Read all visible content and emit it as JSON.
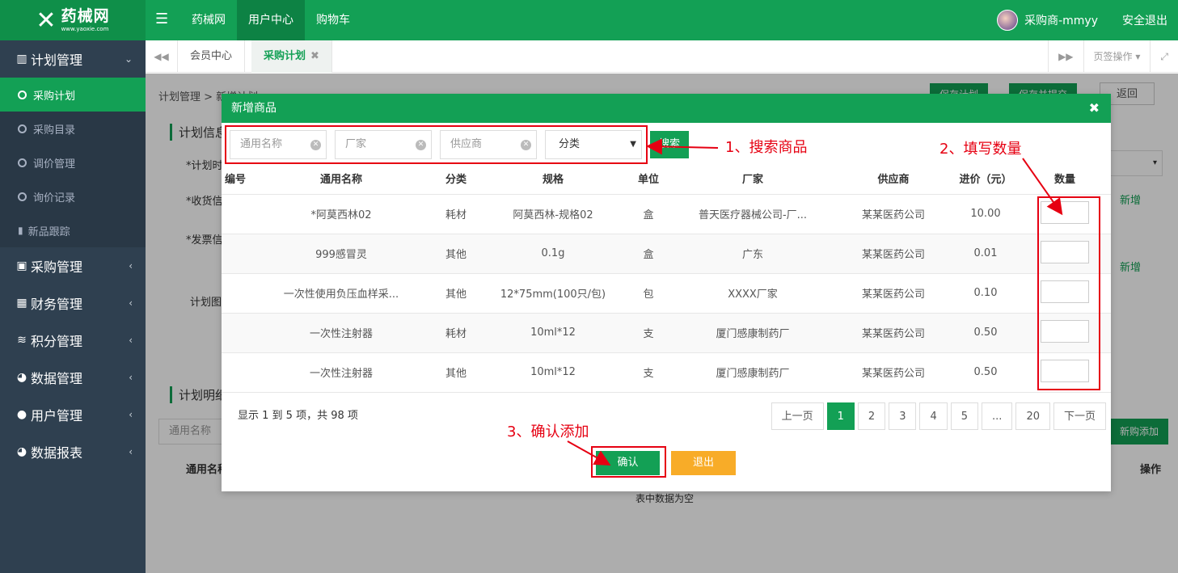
{
  "header": {
    "logo_name": "药械网",
    "logo_url": "www.yaoxie.com",
    "nav": [
      "药械网",
      "用户中心",
      "购物车"
    ],
    "user_name": "采购商-mmyy",
    "logout": "安全退出"
  },
  "sidebar": {
    "groups": [
      {
        "label": "计划管理",
        "icon": "bar-chart-icon"
      },
      {
        "label": "采购管理",
        "icon": "shopping-bag-icon"
      },
      {
        "label": "财务管理",
        "icon": "calculator-icon"
      },
      {
        "label": "积分管理",
        "icon": "database-icon"
      },
      {
        "label": "数据管理",
        "icon": "pie-chart-icon"
      },
      {
        "label": "用户管理",
        "icon": "user-icon"
      },
      {
        "label": "数据报表",
        "icon": "pie-chart-icon"
      }
    ],
    "sub_items": [
      "采购计划",
      "采购目录",
      "调价管理",
      "询价记录",
      "新品跟踪"
    ]
  },
  "tabs": {
    "items": [
      "会员中心",
      "采购计划"
    ],
    "right": [
      "页签操作"
    ]
  },
  "background_page": {
    "breadcrumb": "计划管理 > 新增计划",
    "buttons": [
      "保存计划",
      "保存并提交",
      "返回"
    ],
    "section1": "计划信息",
    "labels": [
      "*计划时",
      "*收货信",
      "*发票信",
      "计划图"
    ],
    "add_links": [
      "新增",
      "新增"
    ],
    "section2": "计划明细",
    "filter_placeholder": "通用名称",
    "add_button": "新购添加",
    "col_name": "通用名称",
    "col_op": "操作",
    "empty": "表中数据为空"
  },
  "modal": {
    "title": "新增商品",
    "search": {
      "name_placeholder": "通用名称",
      "maker_placeholder": "厂家",
      "supplier_placeholder": "供应商",
      "category": "分类",
      "button": "搜索"
    },
    "columns": [
      "编号",
      "通用名称",
      "分类",
      "规格",
      "单位",
      "厂家",
      "供应商",
      "进价（元）",
      "数量"
    ],
    "rows": [
      [
        "",
        "*阿莫西林02",
        "耗材",
        "阿莫西林-规格02",
        "盒",
        "普天医疗器械公司-厂...",
        "某某医药公司",
        "10.00"
      ],
      [
        "",
        "999感冒灵",
        "其他",
        "0.1g",
        "盒",
        "广东",
        "某某医药公司",
        "0.01"
      ],
      [
        "",
        "一次性使用负压血样采...",
        "其他",
        "12*75mm(100只/包)",
        "包",
        "XXXX厂家",
        "某某医药公司",
        "0.10"
      ],
      [
        "",
        "一次性注射器",
        "耗材",
        "10ml*12",
        "支",
        "厦门感康制药厂",
        "某某医药公司",
        "0.50"
      ],
      [
        "",
        "一次性注射器",
        "其他",
        "10ml*12",
        "支",
        "厦门感康制药厂",
        "某某医药公司",
        "0.50"
      ]
    ],
    "pager_info": "显示 1 到 5 项，共 98 项",
    "pager": [
      "上一页",
      "1",
      "2",
      "3",
      "4",
      "5",
      "...",
      "20",
      "下一页"
    ],
    "confirm": "确认",
    "exit": "退出"
  },
  "annotations": {
    "step1": "1、搜索商品",
    "step2": "2、填写数量",
    "step3": "3、确认添加"
  },
  "colors": {
    "brand_green": "#13a055",
    "sidebar_dark": "#2f4050",
    "annotation_red": "#e60012",
    "exit_orange": "#f8ac28"
  }
}
